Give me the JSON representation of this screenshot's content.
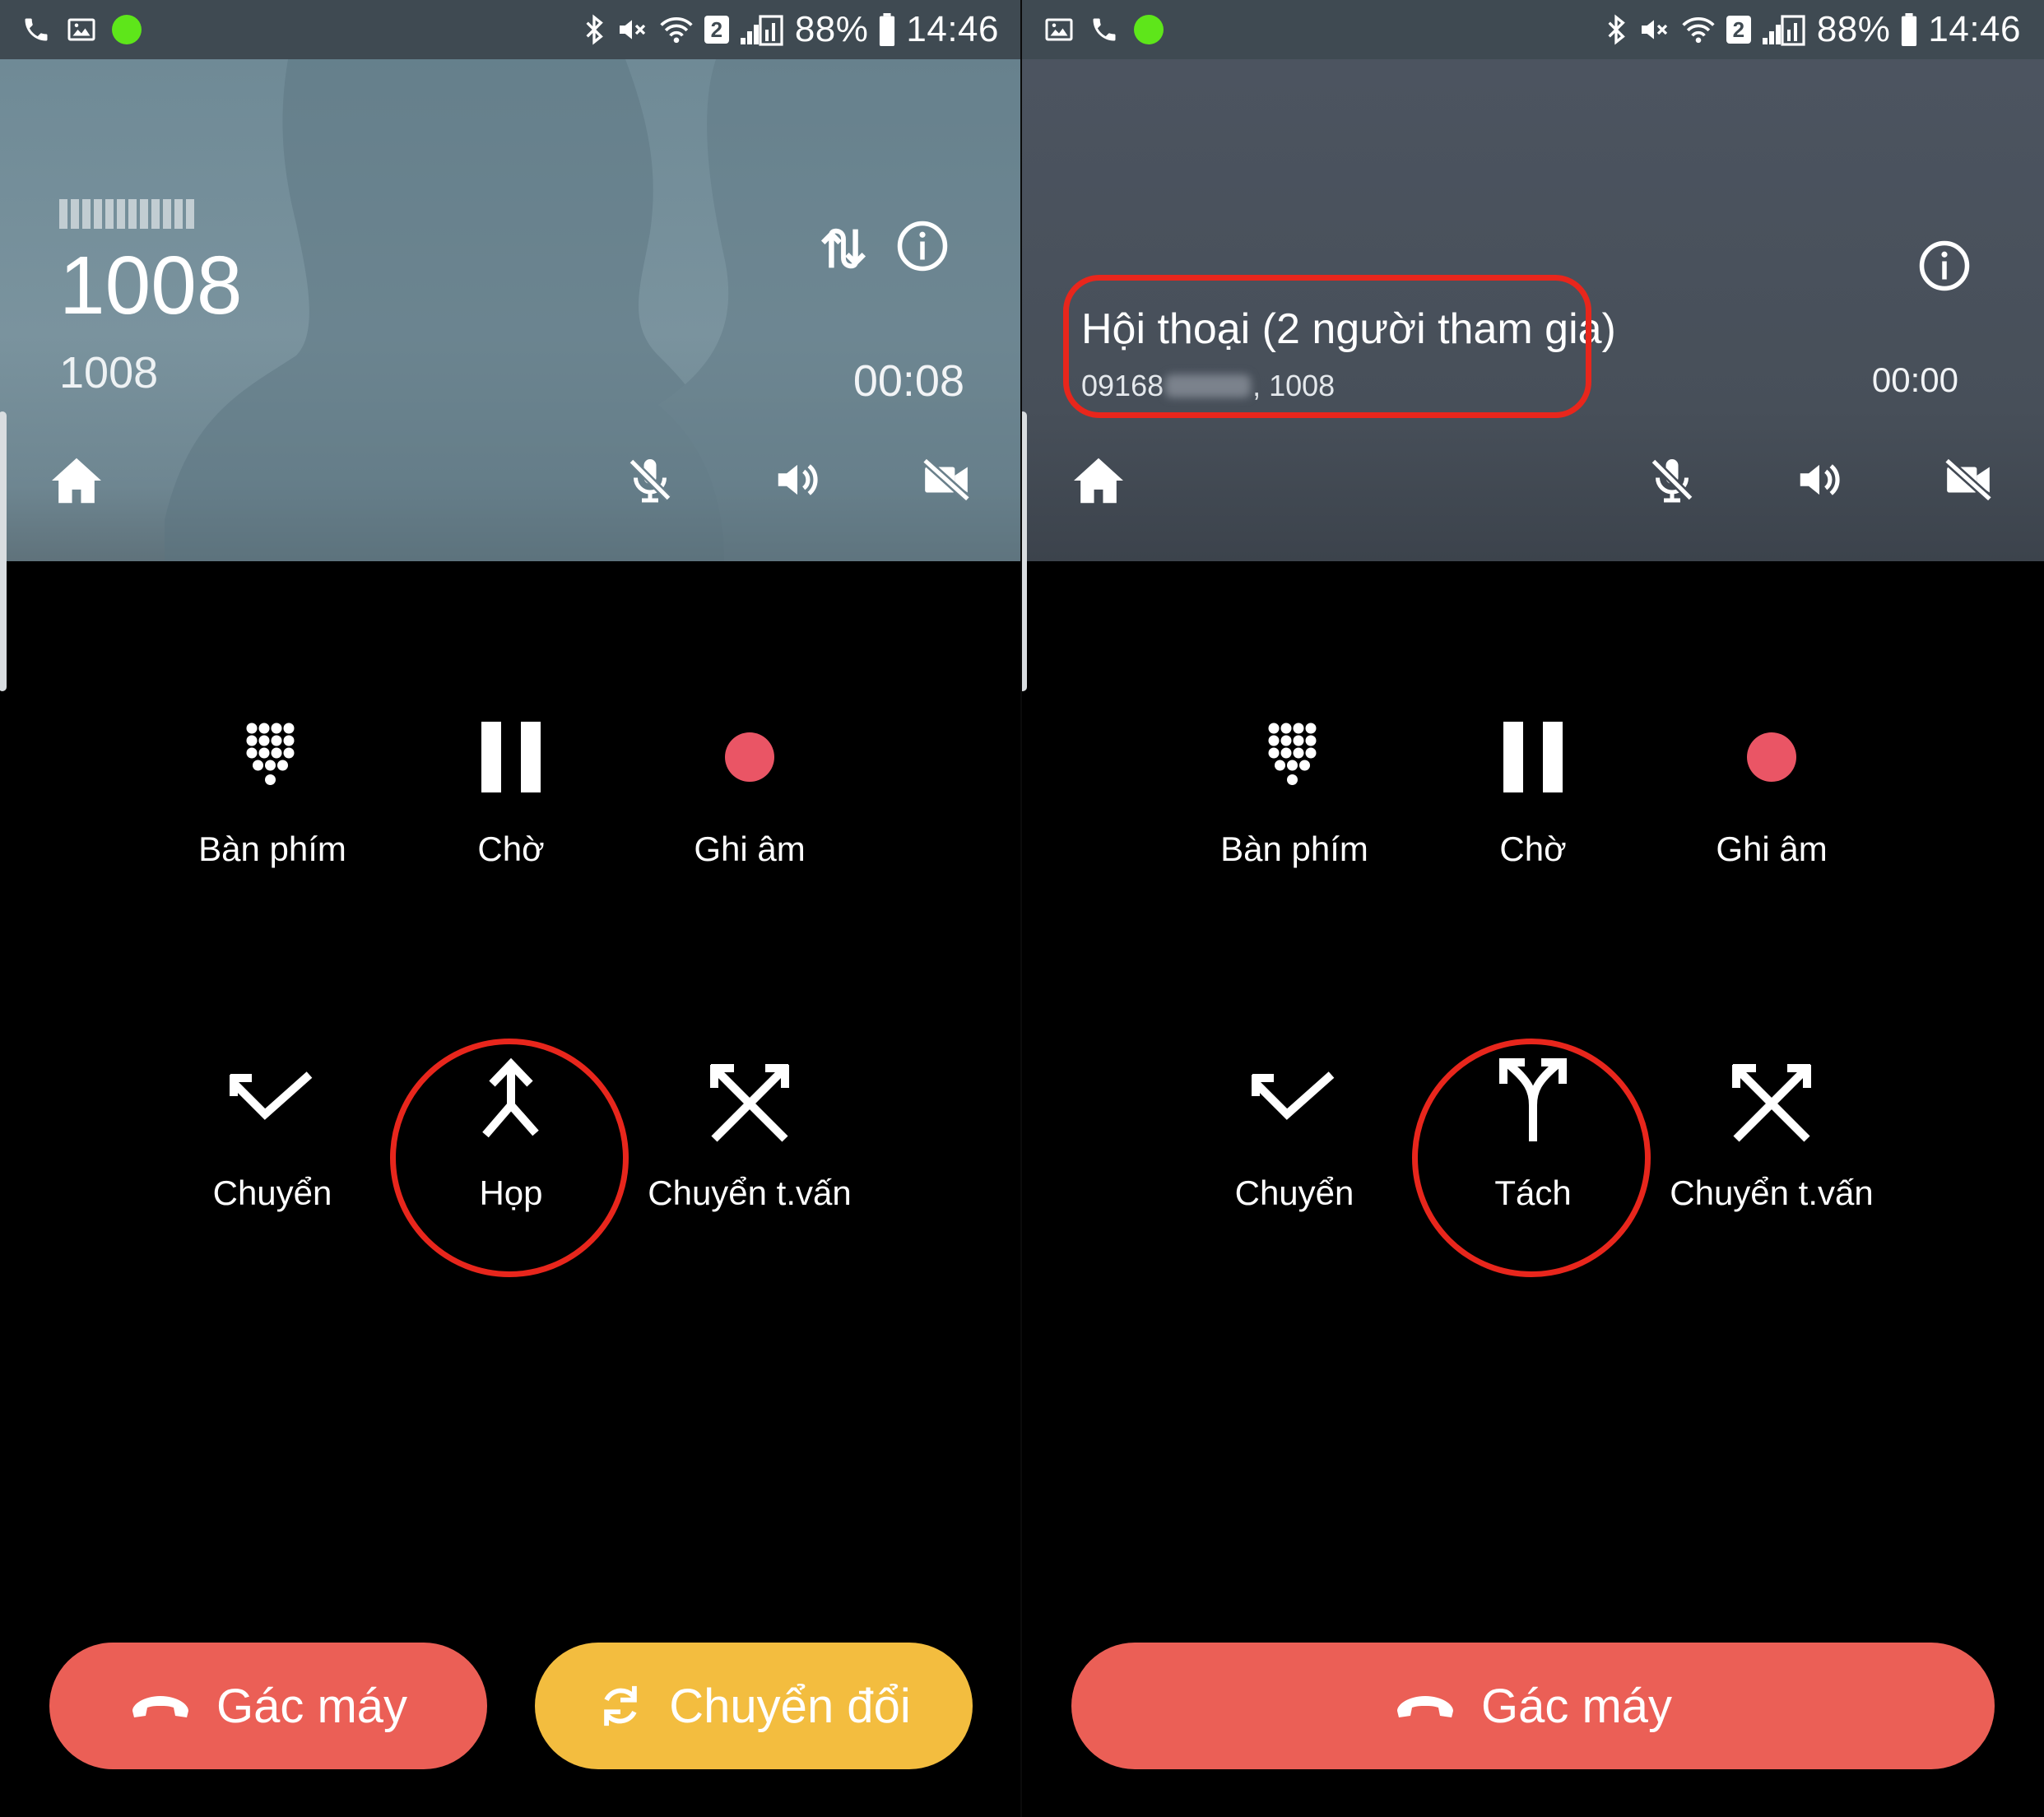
{
  "status_bar": {
    "battery": "88%",
    "time": "14:46",
    "sim_badge": "2"
  },
  "left": {
    "caller": {
      "name": "1008",
      "number": "1008",
      "duration": "00:08"
    },
    "actions": [
      {
        "label": "Bàn phím",
        "icon": "dialpad-icon"
      },
      {
        "label": "Chờ",
        "icon": "pause-icon"
      },
      {
        "label": "Ghi âm",
        "icon": "record-icon"
      },
      {
        "label": "Chuyển",
        "icon": "transfer-icon"
      },
      {
        "label": "Họp",
        "icon": "merge-icon"
      },
      {
        "label": "Chuyển t.vấn",
        "icon": "consult-transfer-icon"
      }
    ],
    "buttons": {
      "hangup": "Gác máy",
      "swap": "Chuyển đổi"
    }
  },
  "right": {
    "conference": {
      "title": "Hội thoại (2 người tham gia)",
      "participant_prefix": "09168",
      "participant_suffix": ", 1008",
      "duration": "00:00"
    },
    "actions": [
      {
        "label": "Bàn phím",
        "icon": "dialpad-icon"
      },
      {
        "label": "Chờ",
        "icon": "pause-icon"
      },
      {
        "label": "Ghi âm",
        "icon": "record-icon"
      },
      {
        "label": "Chuyển",
        "icon": "transfer-icon"
      },
      {
        "label": "Tách",
        "icon": "split-icon"
      },
      {
        "label": "Chuyển t.vấn",
        "icon": "consult-transfer-icon"
      }
    ],
    "buttons": {
      "hangup": "Gác máy"
    }
  },
  "colors": {
    "hangup": "#eb5f56",
    "swap": "#f3bd3f",
    "record": "#ea5565",
    "highlight": "#e8261c",
    "online": "#5ee61a"
  }
}
